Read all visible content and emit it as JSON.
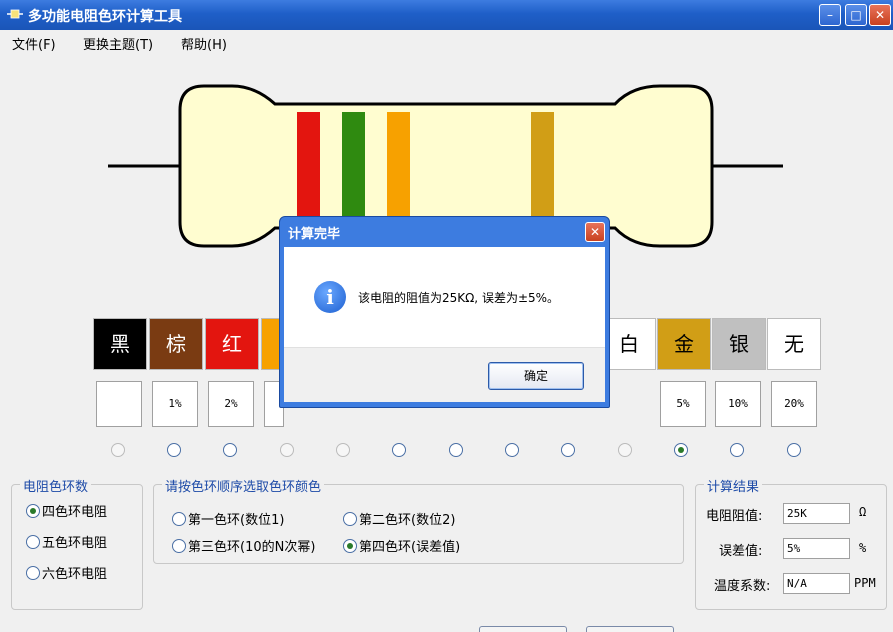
{
  "window": {
    "title": "多功能电阻色环计算工具",
    "minimize_glyph": "–",
    "maximize_glyph": "□",
    "close_glyph": "✕"
  },
  "menu": [
    {
      "label": "文件(F)"
    },
    {
      "label": "更换主题(T)"
    },
    {
      "label": "帮助(H)"
    }
  ],
  "resistor": {
    "body_color": "#fffdd0",
    "bands": [
      "#e3150f",
      "#2f8a10",
      "#f7a100",
      "#d19e16"
    ]
  },
  "swatches": [
    {
      "label": "黑",
      "bg": "#000000",
      "fg": "#ffffff"
    },
    {
      "label": "棕",
      "bg": "#7a3b12",
      "fg": "#ffffff"
    },
    {
      "label": "红",
      "bg": "#e3150f",
      "fg": "#ffffff"
    },
    {
      "label": "",
      "bg": "#f7a100",
      "fg": "#000000"
    },
    {
      "label": "白",
      "bg": "#ffffff",
      "fg": "#000000"
    },
    {
      "label": "金",
      "bg": "#d19e16",
      "fg": "#000000"
    },
    {
      "label": "银",
      "bg": "#c0c0c0",
      "fg": "#000000"
    },
    {
      "label": "无",
      "bg": "#ffffff",
      "fg": "#000000"
    }
  ],
  "tolerance_values": [
    "",
    "1%",
    "2%",
    "",
    "",
    "",
    "",
    "",
    "",
    "",
    "5%",
    "10%",
    "20%"
  ],
  "color_radios": [
    "dim",
    "on",
    "on",
    "dim",
    "dim",
    "on",
    "on",
    "on",
    "on",
    "dim",
    "checked",
    "on",
    "on"
  ],
  "band_count_group": {
    "title": "电阻色环数",
    "options": [
      {
        "label": "四色环电阻",
        "checked": true
      },
      {
        "label": "五色环电阻",
        "checked": false
      },
      {
        "label": "六色环电阻",
        "checked": false
      }
    ]
  },
  "band_select_group": {
    "title": "请按色环顺序选取色环颜色",
    "options": [
      {
        "label": "第一色环(数位1)",
        "checked": false
      },
      {
        "label": "第二色环(数位2)",
        "checked": false
      },
      {
        "label": "第三色环(10的N次幂)",
        "checked": false
      },
      {
        "label": "第四色环(误差值)",
        "checked": true
      }
    ]
  },
  "result_group": {
    "title": "计算结果",
    "resistance_label": "电阻阻值:",
    "resistance_value": "25K",
    "resistance_unit": "Ω",
    "tolerance_label": "误差值:",
    "tolerance_value": "5%",
    "tolerance_unit": "%",
    "tempco_label": "温度系数:",
    "tempco_value": "N/A",
    "tempco_unit": "PPM"
  },
  "dialog": {
    "title": "计算完毕",
    "message": "该电阻的阻值为25KΩ, 误差为±5%。",
    "ok_label": "确定",
    "icon": "info-icon"
  }
}
